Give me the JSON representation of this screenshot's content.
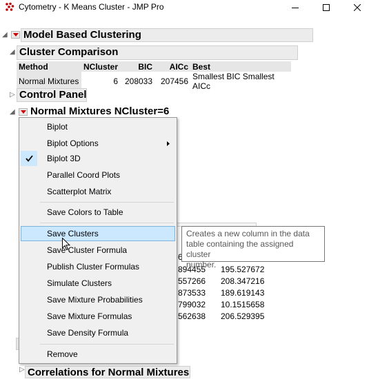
{
  "window": {
    "title": "Cytometry - K Means Cluster - JMP Pro"
  },
  "report": {
    "model_header": "Model Based Clustering",
    "comparison_header": "Cluster Comparison",
    "control_header": "Control Panel",
    "nmix_header": "Normal Mixtures NCluster=6",
    "correlations_header": "Correlations for Normal Mixtures",
    "table": {
      "columns": [
        "Method",
        "NCluster",
        "BIC",
        "AICc",
        "Best"
      ],
      "row": [
        "Normal Mixtures",
        "6",
        "208033",
        "207456",
        "Smallest BIC Smallest AICc"
      ]
    },
    "background_values": [
      {
        "a": "894455",
        "b": "195.527672"
      },
      {
        "a": "557266",
        "b": "208.347216"
      },
      {
        "a": "873533",
        "b": "189.619143"
      },
      {
        "a": "799032",
        "b": "10.1515658"
      },
      {
        "a": "562638",
        "b": "206.529395"
      }
    ],
    "partial_digit": "6"
  },
  "menu": {
    "items": [
      {
        "label": "Biplot"
      },
      {
        "label": "Biplot Options",
        "submenu": true
      },
      {
        "label": "Biplot 3D",
        "checked": true
      },
      {
        "label": "Parallel Coord Plots"
      },
      {
        "label": "Scatterplot Matrix"
      },
      {
        "label": "Save Colors to Table"
      },
      {
        "label": "Save Clusters",
        "highlighted": true
      },
      {
        "label": "Save Cluster Formula"
      },
      {
        "label": "Publish Cluster Formulas"
      },
      {
        "label": "Simulate Clusters"
      },
      {
        "label": "Save Mixture Probabilities"
      },
      {
        "label": "Save Mixture Formulas"
      },
      {
        "label": "Save Density Formula"
      },
      {
        "label": "Remove"
      }
    ]
  },
  "tooltip": {
    "line1": "Creates a new column in the data",
    "line2": "table containing the assigned cluster",
    "line3": "number."
  },
  "colors": {
    "hotspot_red": "#cc0000",
    "highlight_bg": "#cce8ff",
    "highlight_border": "#7ab3e0"
  }
}
